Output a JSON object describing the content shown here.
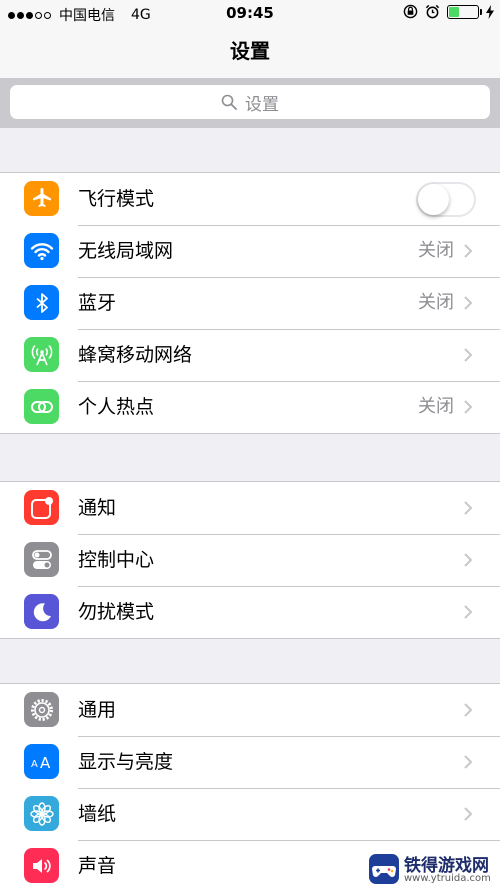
{
  "status_bar": {
    "carrier": "中国电信",
    "network": "4G",
    "time": "09:45"
  },
  "nav": {
    "title": "设置"
  },
  "search": {
    "placeholder": "设置"
  },
  "groups": [
    {
      "items": [
        {
          "label": "飞行模式",
          "icon": "airplane-icon",
          "color": "#ff9500",
          "toggle": false
        },
        {
          "label": "无线局域网",
          "icon": "wifi-icon",
          "color": "#007aff",
          "value": "关闭"
        },
        {
          "label": "蓝牙",
          "icon": "bluetooth-icon",
          "color": "#007aff",
          "value": "关闭"
        },
        {
          "label": "蜂窝移动网络",
          "icon": "cellular-icon",
          "color": "#4cd964"
        },
        {
          "label": "个人热点",
          "icon": "hotspot-icon",
          "color": "#4cd964",
          "value": "关闭"
        }
      ]
    },
    {
      "items": [
        {
          "label": "通知",
          "icon": "notifications-icon",
          "color": "#ff3b30"
        },
        {
          "label": "控制中心",
          "icon": "control-center-icon",
          "color": "#8e8e93"
        },
        {
          "label": "勿扰模式",
          "icon": "moon-icon",
          "color": "#5856d6"
        }
      ]
    },
    {
      "items": [
        {
          "label": "通用",
          "icon": "gear-icon",
          "color": "#8e8e93"
        },
        {
          "label": "显示与亮度",
          "icon": "display-brightness-icon",
          "color": "#007aff"
        },
        {
          "label": "墙纸",
          "icon": "wallpaper-icon",
          "color": "#34aadc"
        },
        {
          "label": "声音",
          "icon": "sound-icon",
          "color": "#ff2d55"
        }
      ]
    }
  ],
  "watermark": {
    "name": "铁得游戏网",
    "url": "www.ytruida.com"
  }
}
